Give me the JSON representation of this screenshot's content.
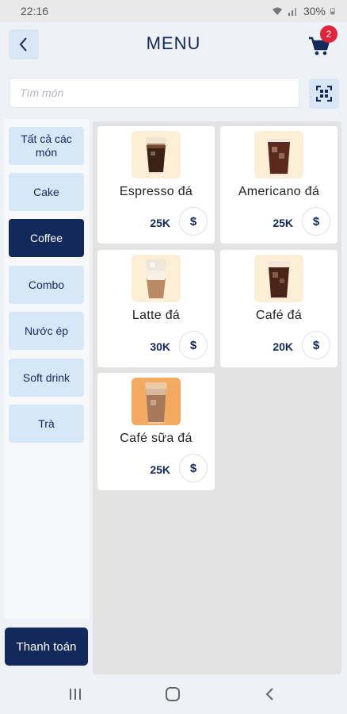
{
  "status_bar": {
    "time": "22:16",
    "battery": "30%"
  },
  "header": {
    "title": "MENU",
    "cart_count": "2"
  },
  "search": {
    "placeholder": "Tìm món",
    "value": ""
  },
  "categories": [
    {
      "label": "Tất cả các món",
      "active": false
    },
    {
      "label": "Cake",
      "active": false
    },
    {
      "label": "Coffee",
      "active": true
    },
    {
      "label": "Combo",
      "active": false
    },
    {
      "label": "Nước ép",
      "active": false
    },
    {
      "label": "Soft drink",
      "active": false
    },
    {
      "label": "Trà",
      "active": false
    }
  ],
  "checkout_label": "Thanh toán",
  "products": [
    {
      "name": "Espresso đá",
      "price": "25K",
      "button": "$",
      "image": "iced-espresso-glass"
    },
    {
      "name": "Americano đá",
      "price": "25K",
      "button": "$",
      "image": "iced-americano-glass"
    },
    {
      "name": "Latte đá",
      "price": "30K",
      "button": "$",
      "image": "iced-latte-glass"
    },
    {
      "name": "Café đá",
      "price": "20K",
      "button": "$",
      "image": "iced-coffee-glass"
    },
    {
      "name": "Café sữa đá",
      "price": "25K",
      "button": "$",
      "image": "iced-milk-coffee-glass"
    }
  ],
  "colors": {
    "primary": "#13295c",
    "accent_light": "#d6e8f7",
    "badge": "#e0243b",
    "thumb_bg": "#fdeed6",
    "thumb_bg_orange": "#f4a960"
  }
}
